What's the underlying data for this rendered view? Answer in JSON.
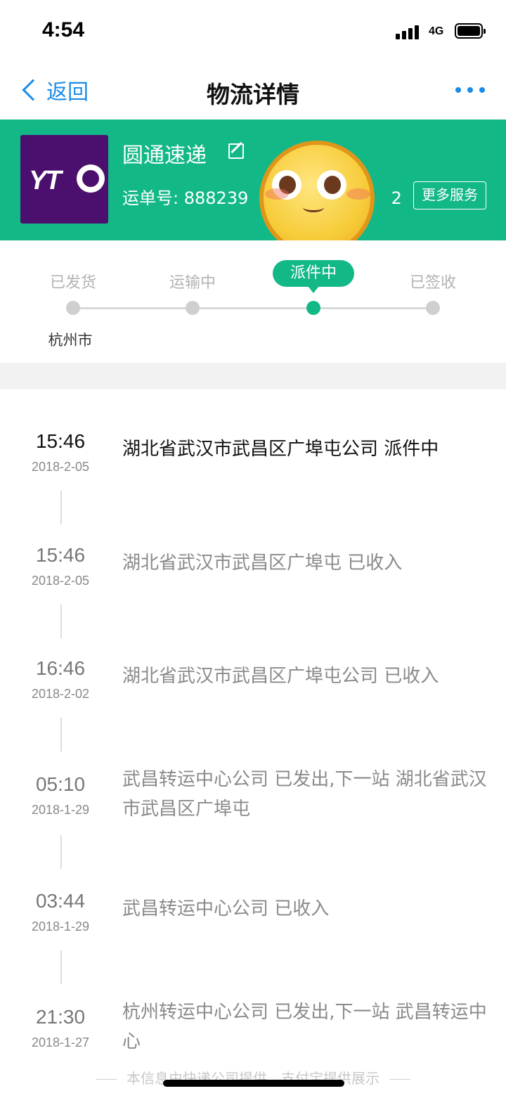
{
  "status_bar": {
    "time": "4:54",
    "network": "4G"
  },
  "nav": {
    "back_label": "返回",
    "title": "物流详情"
  },
  "courier": {
    "name": "圆通速递",
    "logo_text": "YT",
    "waybill_prefix": "运单号:",
    "waybill_visible_start": "888239",
    "waybill_visible_end": "2",
    "more_services_label": "更多服务",
    "brand_color": "#13b887",
    "logo_bg": "#4b0f6e"
  },
  "progress": {
    "stages": [
      "已发货",
      "运输中",
      "派件中",
      "已签收"
    ],
    "active_stage": "派件中",
    "origin_city": "杭州市"
  },
  "timeline": [
    {
      "time": "15:46",
      "date": "2018-2-05",
      "text": "湖北省武汉市武昌区广埠屯公司 派件中"
    },
    {
      "time": "15:46",
      "date": "2018-2-05",
      "text": "湖北省武汉市武昌区广埠屯 已收入"
    },
    {
      "time": "16:46",
      "date": "2018-2-02",
      "text": "湖北省武汉市武昌区广埠屯公司 已收入"
    },
    {
      "time": "05:10",
      "date": "2018-1-29",
      "text": "武昌转运中心公司 已发出,下一站 湖北省武汉市武昌区广埠屯"
    },
    {
      "time": "03:44",
      "date": "2018-1-29",
      "text": "武昌转运中心公司 已收入"
    },
    {
      "time": "21:30",
      "date": "2018-1-27",
      "text": "杭州转运中心公司 已发出,下一站 武昌转运中心"
    }
  ],
  "footer": "本信息由快递公司提供，支付宝提供展示"
}
